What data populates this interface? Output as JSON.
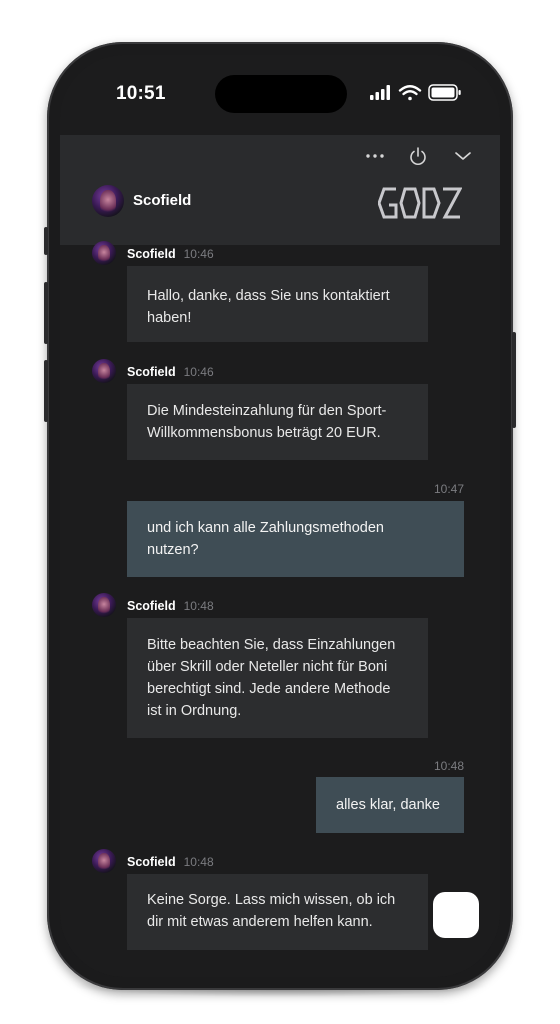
{
  "status_bar": {
    "time": "10:51",
    "icons": [
      "signal-icon",
      "wifi-icon",
      "battery-icon"
    ]
  },
  "header": {
    "controls": [
      "more-icon",
      "power-icon",
      "chevron-down-icon"
    ],
    "agent_name": "Scofield",
    "brand_logo_text": "GODZ"
  },
  "messages": [
    {
      "sender": "Scofield",
      "time": "10:46",
      "lines": [
        "Hallo, danke, dass Sie uns kontaktiert",
        "haben!"
      ]
    },
    {
      "sender": "Scofield",
      "time": "10:46",
      "lines": [
        "Die Mindesteinzahlung für den Sport-",
        "Willkommensbonus beträgt 20 EUR."
      ]
    },
    {
      "sender": "user",
      "time": "10:47",
      "lines": [
        "und ich kann alle Zahlungsmethoden",
        "nutzen?"
      ]
    },
    {
      "sender": "Scofield",
      "time": "10:48",
      "lines": [
        "Bitte beachten Sie, dass Einzahlungen",
        "über Skrill oder Neteller nicht für Boni",
        "berechtigt sind. Jede andere Methode",
        "ist in Ordnung."
      ]
    },
    {
      "sender": "user",
      "time": "10:48",
      "lines": [
        "alles klar, danke"
      ]
    },
    {
      "sender": "Scofield",
      "time": "10:48",
      "lines": [
        "Keine Sorge. Lass mich wissen, ob ich",
        "dir mit etwas anderem helfen kann."
      ]
    }
  ],
  "colors": {
    "frame": "#1b1b1c",
    "screen_bg": "#1c1c1d",
    "header_bg": "#2a2b2d",
    "agent_bubble": "#2c2d2f",
    "user_bubble": "#3f4d55",
    "timestamp": "#7b7c80"
  }
}
